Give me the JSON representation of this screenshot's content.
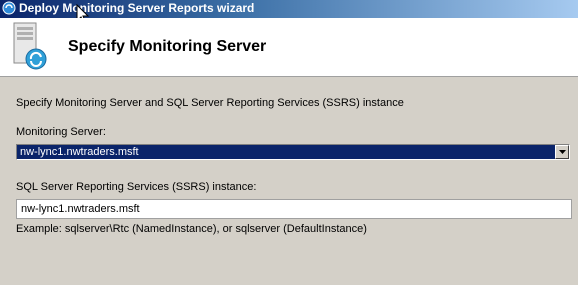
{
  "window": {
    "title": "Deploy Monitoring Server Reports wizard"
  },
  "header": {
    "title": "Specify Monitoring Server"
  },
  "main": {
    "description": "Specify Monitoring Server and SQL Server Reporting Services (SSRS) instance",
    "monitoring_server_label": "Monitoring Server:",
    "monitoring_server_value": "nw-lync1.nwtraders.msft",
    "ssrs_label": "SQL Server Reporting Services (SSRS) instance:",
    "ssrs_value": "nw-lync1.nwtraders.msft",
    "example": "Example: sqlserver\\Rtc (NamedInstance), or sqlserver (DefaultInstance)"
  },
  "icons": {
    "title_icon": "app-icon",
    "header_icon": "server-refresh-icon",
    "dropdown_icon": "chevron-down-icon"
  }
}
